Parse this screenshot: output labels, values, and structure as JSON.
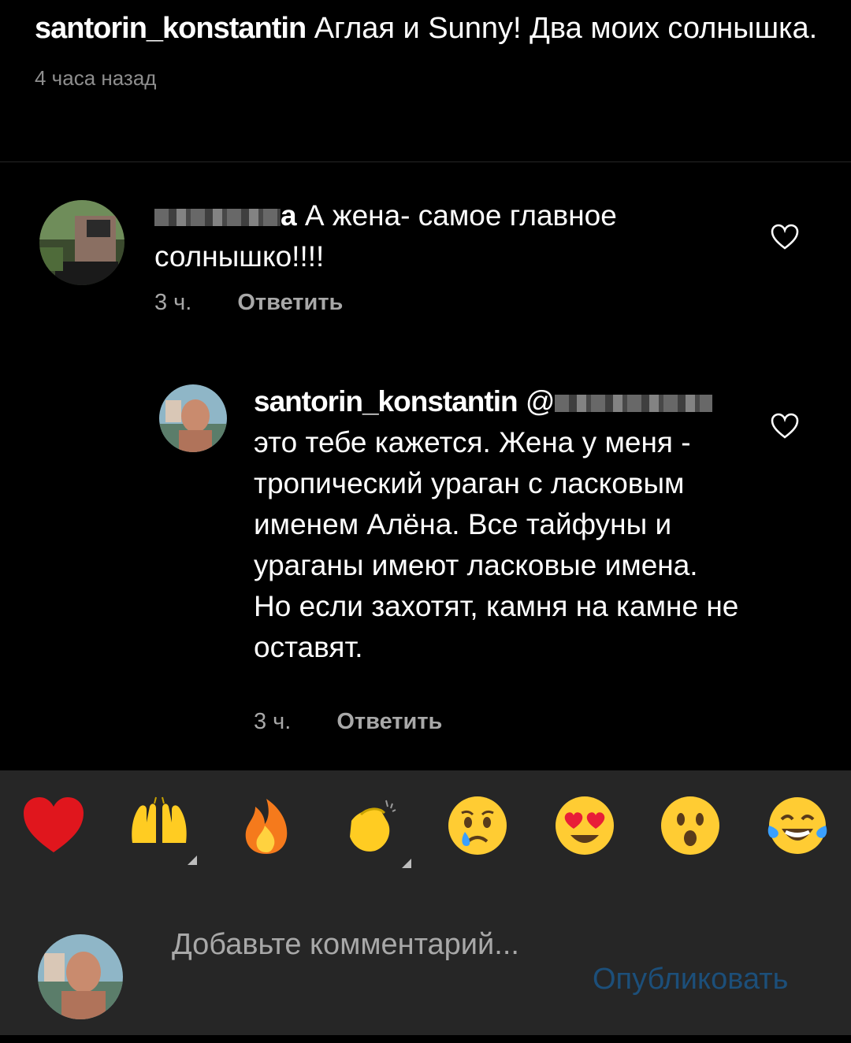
{
  "caption": {
    "username": "santorin_konstantin",
    "text": " Аглая и Sunny! Два моих солнышка.",
    "time": "4 часа назад"
  },
  "comment1": {
    "username_visible_suffix": "a",
    "text": " А жена- самое главное солнышко!!!!",
    "time": "3 ч.",
    "reply_label": "Ответить"
  },
  "comment2": {
    "username": "santorin_konstantin",
    "mention_prefix": "@",
    "text": "это тебе кажется. Жена у меня - тропический ураган с ласковым именем Алёна. Все тайфуны и ураганы имеют ласковые имена. Но если захотят, камня на камне не оставят.",
    "time": "3 ч.",
    "reply_label": "Ответить"
  },
  "emojis": [
    {
      "name": "red-heart",
      "char": "❤️"
    },
    {
      "name": "raising-hands",
      "char": "🙌"
    },
    {
      "name": "fire",
      "char": "🔥"
    },
    {
      "name": "clapping-hands",
      "char": "👏"
    },
    {
      "name": "crying-face",
      "char": "😢"
    },
    {
      "name": "heart-eyes",
      "char": "😍"
    },
    {
      "name": "astonished-face",
      "char": "😮"
    },
    {
      "name": "tears-of-joy",
      "char": "😂"
    }
  ],
  "input": {
    "placeholder": "Добавьте комментарий...",
    "publish_label": "Опубликовать"
  },
  "colors": {
    "background": "#000000",
    "panel": "#262626",
    "secondary_text": "#a8a8a8",
    "publish_disabled": "#1c4f7a"
  }
}
